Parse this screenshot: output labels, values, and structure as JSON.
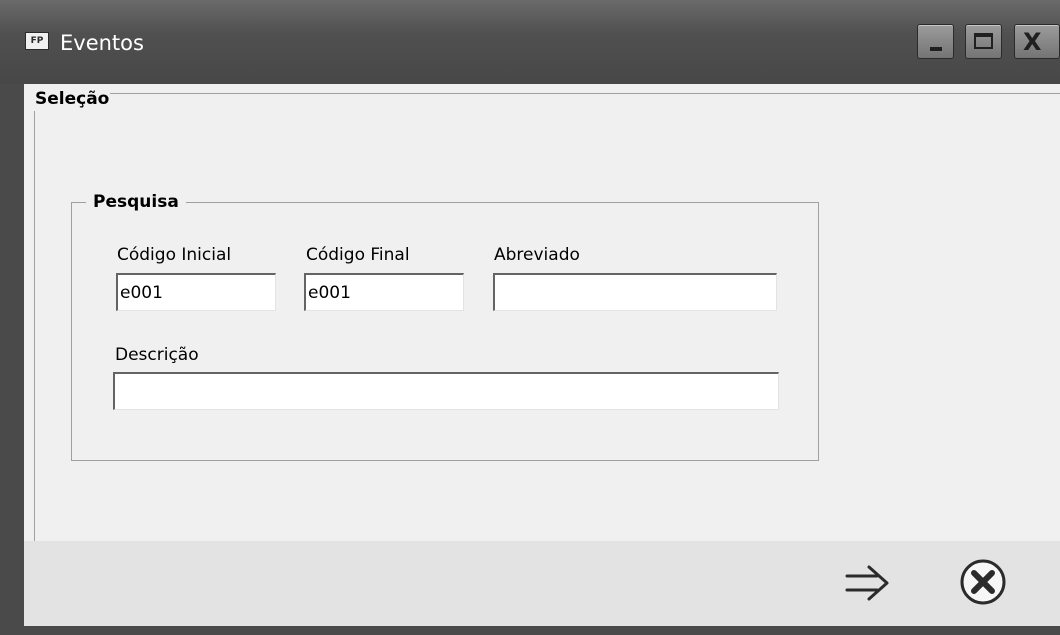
{
  "window": {
    "title": "Eventos",
    "icon_text": "FP",
    "icon": "fp-app-icon"
  },
  "title_buttons": {
    "minimize_icon": "minimize-icon",
    "maximize_icon": "maximize-icon",
    "close_icon": "close-icon",
    "close_glyph": "X"
  },
  "selecao": {
    "legend": "Seleção"
  },
  "pesquisa": {
    "legend": "Pesquisa",
    "codigo_inicial": {
      "label": "Código Inicial",
      "value": "e001"
    },
    "codigo_final": {
      "label": "Código Final",
      "value": "e001"
    },
    "abreviado": {
      "label": "Abreviado",
      "value": ""
    },
    "descricao": {
      "label": "Descrição",
      "value": ""
    }
  },
  "footer": {
    "confirm_icon": "arrow-right-icon",
    "cancel_icon": "cancel-circle-icon"
  },
  "colors": {
    "titlebar": "#4f4f4f",
    "client_bg": "#f0f0f0",
    "footer_bg": "#e3e3e3",
    "icon_dark": "#2b2b2b"
  }
}
